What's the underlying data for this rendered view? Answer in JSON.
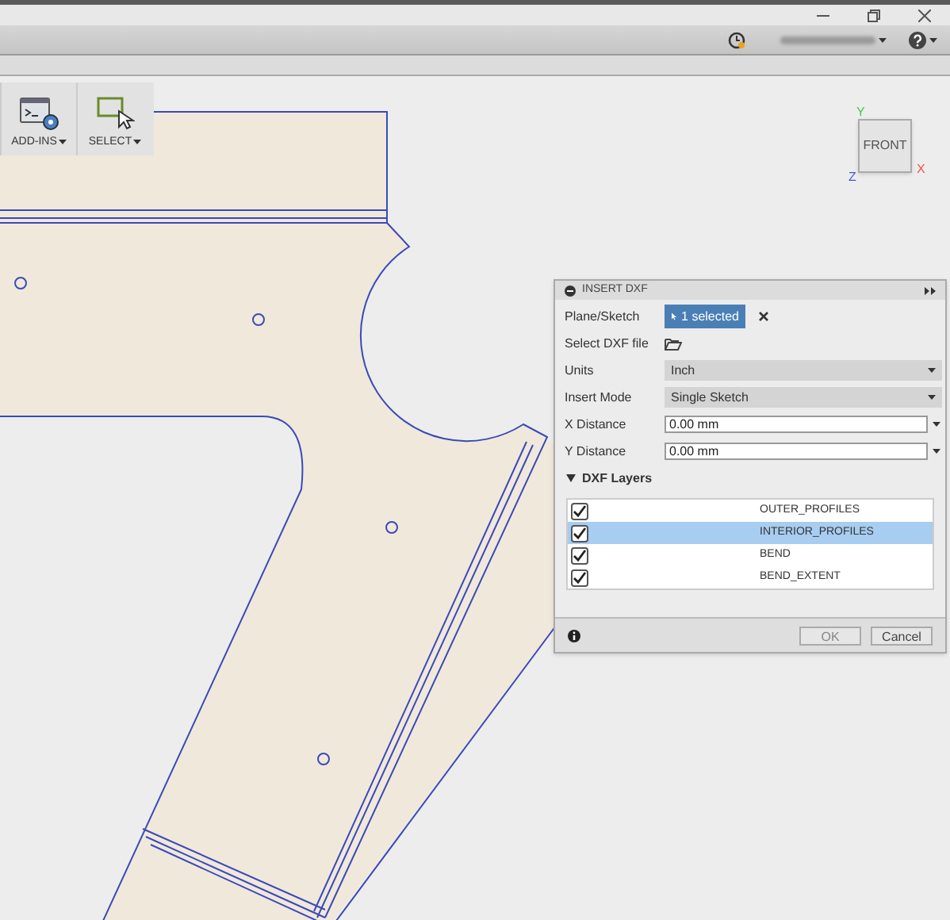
{
  "toolbar": {
    "items": [
      {
        "label": "ADD-INS",
        "kind": "addins"
      },
      {
        "label": "SELECT",
        "kind": "select"
      }
    ]
  },
  "viewcube": {
    "face": "FRONT",
    "axes": [
      "Y",
      "X",
      "Z"
    ]
  },
  "dialog": {
    "title": "INSERT DXF",
    "rows": [
      {
        "kind": "selection",
        "label": "Plane/Sketch",
        "value": "1 selected"
      },
      {
        "kind": "file",
        "label": "Select DXF file"
      },
      {
        "kind": "dropdown",
        "label": "Units",
        "value": "Inch"
      },
      {
        "kind": "dropdown",
        "label": "Insert Mode",
        "value": "Single Sketch"
      },
      {
        "kind": "input",
        "label": "X Distance",
        "value": "0.00 mm"
      },
      {
        "kind": "input",
        "label": "Y Distance",
        "value": "0.00 mm"
      }
    ],
    "layers_group": {
      "label": "DXF Layers",
      "expanded": true
    },
    "layers": [
      {
        "name": "OUTER_PROFILES",
        "checked": true,
        "selected": false
      },
      {
        "name": "INTERIOR_PROFILES",
        "checked": true,
        "selected": true
      },
      {
        "name": "BEND",
        "checked": true,
        "selected": false
      },
      {
        "name": "BEND_EXTENT",
        "checked": true,
        "selected": false
      }
    ],
    "buttons": [
      "OK",
      "Cancel"
    ]
  }
}
